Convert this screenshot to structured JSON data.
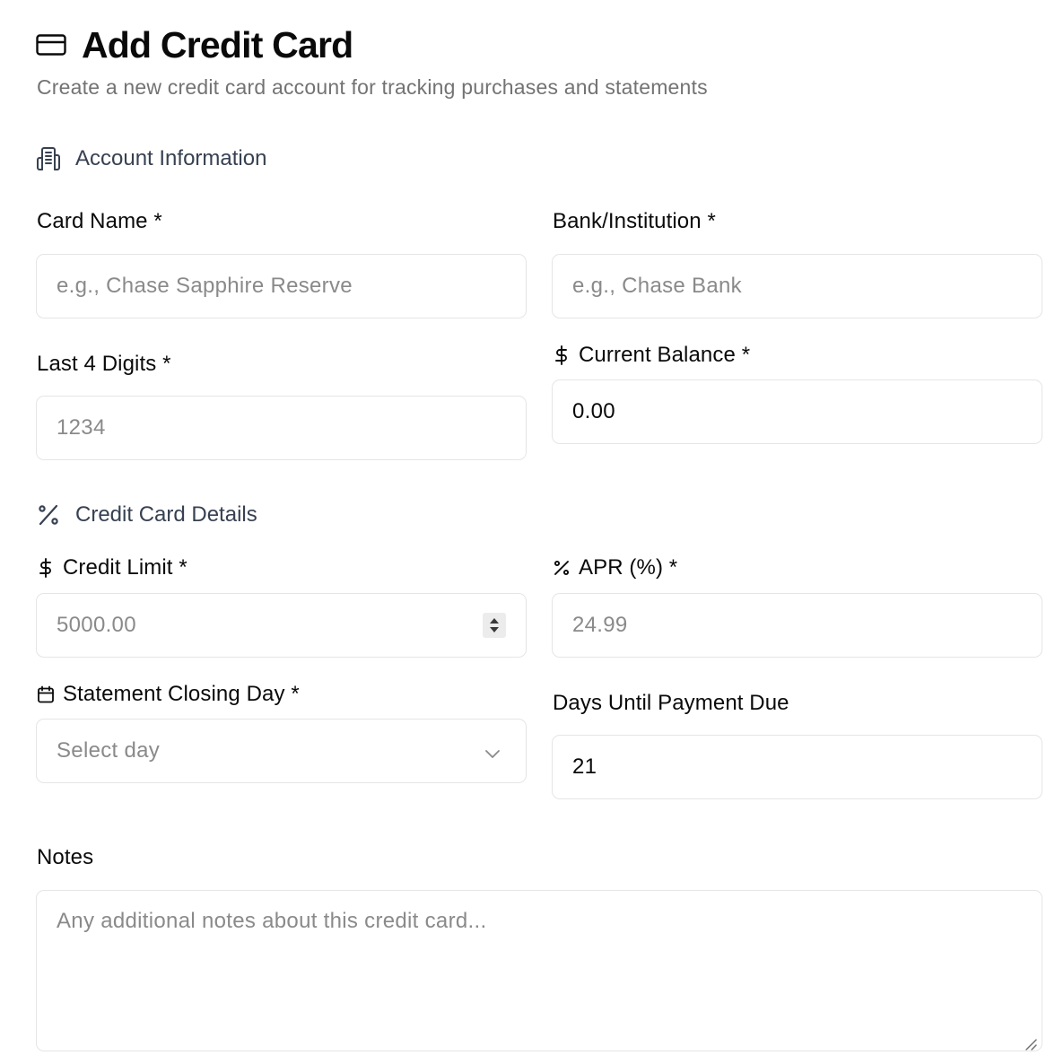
{
  "header": {
    "title": "Add Credit Card",
    "subtitle": "Create a new credit card account for tracking purchases and statements",
    "icon": "credit-card-icon"
  },
  "account_section": {
    "title": "Account Information",
    "icon": "building-icon",
    "card_name": {
      "label": "Card Name *",
      "placeholder": "e.g., Chase Sapphire Reserve",
      "value": ""
    },
    "bank": {
      "label": "Bank/Institution *",
      "placeholder": "e.g., Chase Bank",
      "value": ""
    },
    "last4": {
      "label": "Last 4 Digits *",
      "placeholder": "1234",
      "value": ""
    },
    "balance": {
      "label": "Current Balance *",
      "icon": "dollar-sign-icon",
      "value": "0.00"
    }
  },
  "details_section": {
    "title": "Credit Card Details",
    "icon": "percent-icon",
    "credit_limit": {
      "label": "Credit Limit *",
      "icon": "dollar-sign-icon",
      "placeholder": "5000.00",
      "value": ""
    },
    "apr": {
      "label": "APR (%) *",
      "icon": "percent-icon",
      "placeholder": "24.99",
      "value": ""
    },
    "closing_day": {
      "label": "Statement Closing Day *",
      "icon": "calendar-icon",
      "selected": "Select day"
    },
    "payment_due": {
      "label": "Days Until Payment Due",
      "value": "21"
    }
  },
  "notes": {
    "label": "Notes",
    "placeholder": "Any additional notes about this credit card..."
  },
  "colors": {
    "text": "#0a0a0a",
    "muted": "#737373",
    "placeholder": "#8a8a8a",
    "section": "#374151",
    "border": "#e5e5e5"
  }
}
